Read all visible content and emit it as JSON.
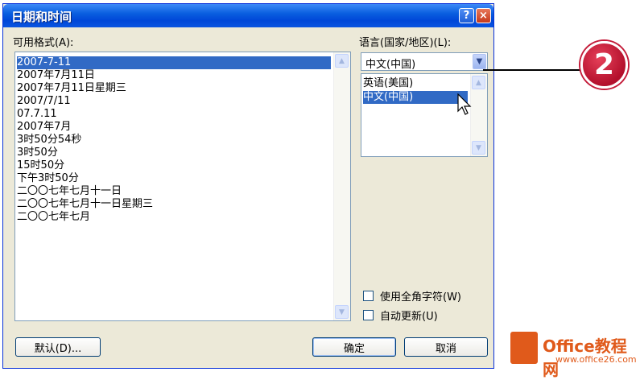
{
  "dialog": {
    "title": "日期和时间",
    "help_glyph": "?",
    "close_glyph": "×"
  },
  "formats": {
    "label": "可用格式(A):",
    "items": [
      "2007-7-11",
      "2007年7月11日",
      "2007年7月11日星期三",
      "2007/7/11",
      "07.7.11",
      "2007年7月",
      "3时50分54秒",
      "3时50分",
      "15时50分",
      "下午3时50分",
      "二〇〇七年七月十一日",
      "二〇〇七年七月十一日星期三",
      "二〇〇七年七月"
    ],
    "selected_index": 0
  },
  "language": {
    "label": "语言(国家/地区)(L):",
    "selected": "中文(中国)",
    "options": [
      "英语(美国)",
      "中文(中国)"
    ],
    "highlighted_index": 1
  },
  "options": {
    "fullwidth_label": "使用全角字符(W)",
    "autoupdate_label": "自动更新(U)"
  },
  "buttons": {
    "default_label": "默认(D)...",
    "ok_label": "确定",
    "cancel_label": "取消"
  },
  "callout": {
    "number": "2"
  },
  "watermark": {
    "brand": "Office教程网",
    "url": "www.office26.com"
  },
  "colors": {
    "selection": "#316ac5",
    "titlebar": "#0a55e0",
    "callout": "#c41c3a",
    "brand": "#e05a1b"
  }
}
